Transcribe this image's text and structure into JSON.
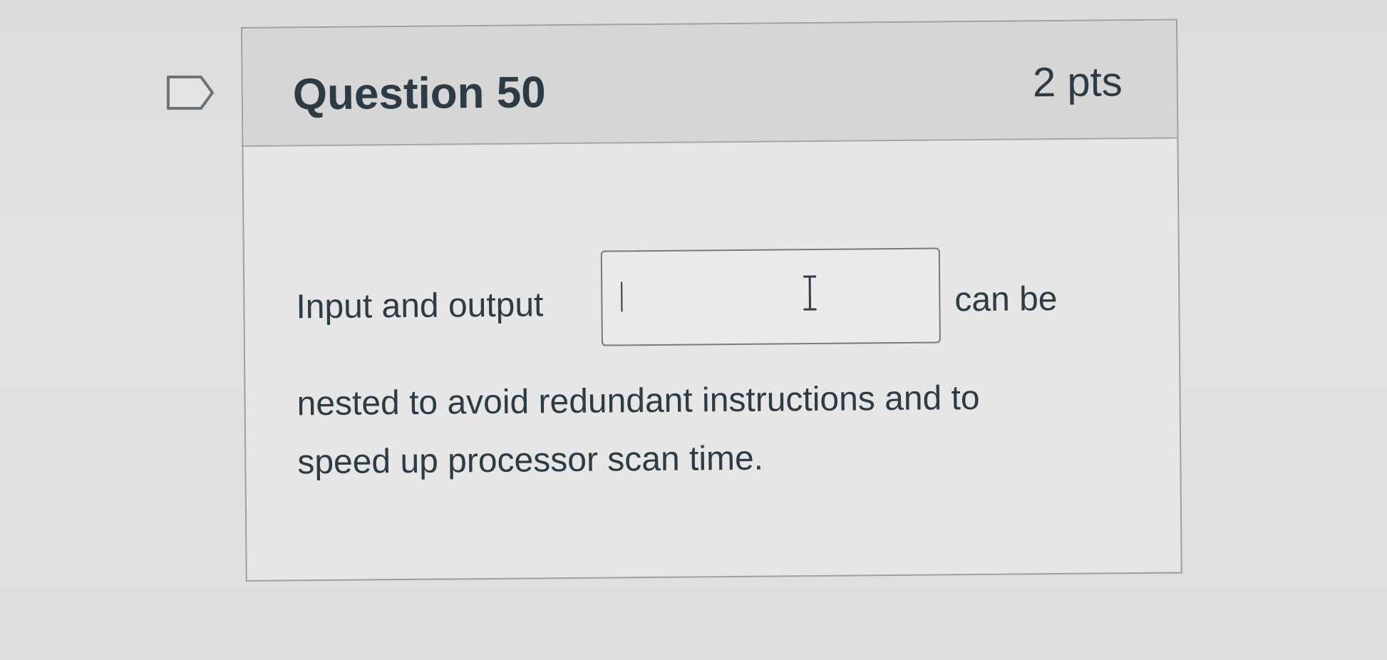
{
  "question": {
    "title": "Question 50",
    "points": "2 pts",
    "flag_icon": "flag-icon",
    "prompt_before": "Input and output",
    "prompt_after": "can be",
    "prompt_line_2": "nested to avoid redundant instructions and to",
    "prompt_line_3": "speed up processor scan time.",
    "answer_value": "",
    "answer_placeholder": "",
    "cursor_icon": "i-beam-cursor-icon"
  }
}
